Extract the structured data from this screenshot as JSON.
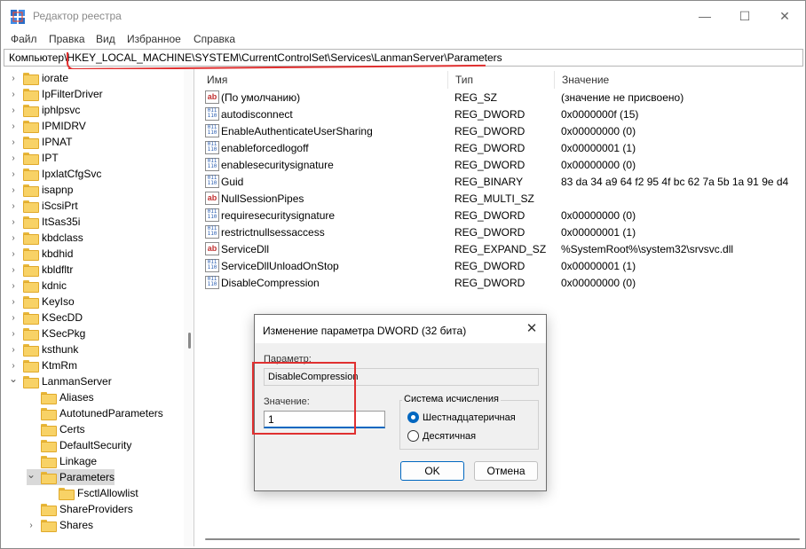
{
  "window": {
    "title": "Редактор реестра",
    "icon": "registry-editor-icon",
    "minimize_glyph": "—",
    "maximize_glyph": "☐",
    "close_glyph": "✕"
  },
  "menu": [
    "Файл",
    "Правка",
    "Вид",
    "Избранное",
    "Справка"
  ],
  "address": "Компьютер\\HKEY_LOCAL_MACHINE\\SYSTEM\\CurrentControlSet\\Services\\LanmanServer\\Parameters",
  "tree": [
    {
      "label": "iorate",
      "expandable": true,
      "expanded": false,
      "depth": 0
    },
    {
      "label": "IpFilterDriver",
      "expandable": true,
      "expanded": false,
      "depth": 0
    },
    {
      "label": "iphlpsvc",
      "expandable": true,
      "expanded": false,
      "depth": 0
    },
    {
      "label": "IPMIDRV",
      "expandable": true,
      "expanded": false,
      "depth": 0
    },
    {
      "label": "IPNAT",
      "expandable": true,
      "expanded": false,
      "depth": 0
    },
    {
      "label": "IPT",
      "expandable": true,
      "expanded": false,
      "depth": 0
    },
    {
      "label": "IpxlatCfgSvc",
      "expandable": true,
      "expanded": false,
      "depth": 0
    },
    {
      "label": "isapnp",
      "expandable": true,
      "expanded": false,
      "depth": 0
    },
    {
      "label": "iScsiPrt",
      "expandable": true,
      "expanded": false,
      "depth": 0
    },
    {
      "label": "ItSas35i",
      "expandable": true,
      "expanded": false,
      "depth": 0
    },
    {
      "label": "kbdclass",
      "expandable": true,
      "expanded": false,
      "depth": 0
    },
    {
      "label": "kbdhid",
      "expandable": true,
      "expanded": false,
      "depth": 0
    },
    {
      "label": "kbldfltr",
      "expandable": true,
      "expanded": false,
      "depth": 0
    },
    {
      "label": "kdnic",
      "expandable": true,
      "expanded": false,
      "depth": 0
    },
    {
      "label": "KeyIso",
      "expandable": true,
      "expanded": false,
      "depth": 0
    },
    {
      "label": "KSecDD",
      "expandable": true,
      "expanded": false,
      "depth": 0
    },
    {
      "label": "KSecPkg",
      "expandable": true,
      "expanded": false,
      "depth": 0
    },
    {
      "label": "ksthunk",
      "expandable": true,
      "expanded": false,
      "depth": 0
    },
    {
      "label": "KtmRm",
      "expandable": true,
      "expanded": false,
      "depth": 0
    },
    {
      "label": "LanmanServer",
      "expandable": true,
      "expanded": true,
      "depth": 0
    },
    {
      "label": "Aliases",
      "expandable": false,
      "expanded": false,
      "depth": 1
    },
    {
      "label": "AutotunedParameters",
      "expandable": false,
      "expanded": false,
      "depth": 1
    },
    {
      "label": "Certs",
      "expandable": false,
      "expanded": false,
      "depth": 1
    },
    {
      "label": "DefaultSecurity",
      "expandable": false,
      "expanded": false,
      "depth": 1
    },
    {
      "label": "Linkage",
      "expandable": false,
      "expanded": false,
      "depth": 1
    },
    {
      "label": "Parameters",
      "expandable": true,
      "expanded": true,
      "depth": 1,
      "selected": true
    },
    {
      "label": "FsctlAllowlist",
      "expandable": false,
      "expanded": false,
      "depth": 2
    },
    {
      "label": "ShareProviders",
      "expandable": false,
      "expanded": false,
      "depth": 1
    },
    {
      "label": "Shares",
      "expandable": true,
      "expanded": false,
      "depth": 1
    }
  ],
  "columns": {
    "name": "Имя",
    "type": "Тип",
    "data": "Значение"
  },
  "values": [
    {
      "icon": "sz",
      "name": "(По умолчанию)",
      "type": "REG_SZ",
      "data": "(значение не присвоено)"
    },
    {
      "icon": "bin",
      "name": "autodisconnect",
      "type": "REG_DWORD",
      "data": "0x0000000f (15)"
    },
    {
      "icon": "bin",
      "name": "EnableAuthenticateUserSharing",
      "type": "REG_DWORD",
      "data": "0x00000000 (0)"
    },
    {
      "icon": "bin",
      "name": "enableforcedlogoff",
      "type": "REG_DWORD",
      "data": "0x00000001 (1)"
    },
    {
      "icon": "bin",
      "name": "enablesecuritysignature",
      "type": "REG_DWORD",
      "data": "0x00000000 (0)"
    },
    {
      "icon": "bin",
      "name": "Guid",
      "type": "REG_BINARY",
      "data": "83 da 34 a9 64 f2 95 4f bc 62 7a 5b 1a 91 9e d4"
    },
    {
      "icon": "sz",
      "name": "NullSessionPipes",
      "type": "REG_MULTI_SZ",
      "data": ""
    },
    {
      "icon": "bin",
      "name": "requiresecuritysignature",
      "type": "REG_DWORD",
      "data": "0x00000000 (0)"
    },
    {
      "icon": "bin",
      "name": "restrictnullsessaccess",
      "type": "REG_DWORD",
      "data": "0x00000001 (1)"
    },
    {
      "icon": "sz",
      "name": "ServiceDll",
      "type": "REG_EXPAND_SZ",
      "data": "%SystemRoot%\\system32\\srvsvc.dll"
    },
    {
      "icon": "bin",
      "name": "ServiceDllUnloadOnStop",
      "type": "REG_DWORD",
      "data": "0x00000001 (1)"
    },
    {
      "icon": "bin",
      "name": "DisableCompression",
      "type": "REG_DWORD",
      "data": "0x00000000 (0)"
    }
  ],
  "dialog": {
    "title": "Изменение параметра DWORD (32 бита)",
    "close_glyph": "✕",
    "param_label": "Параметр:",
    "param_value": "DisableCompression",
    "value_label": "Значение:",
    "value": "1",
    "base_group": "Система исчисления",
    "radio_hex": "Шестнадцатеричная",
    "radio_dec": "Десятичная",
    "hex_checked": true,
    "ok": "OK",
    "cancel": "Отмена"
  },
  "colors": {
    "annotation": "#e03030",
    "accent": "#0067c0",
    "selection": "#d9d9d9"
  }
}
